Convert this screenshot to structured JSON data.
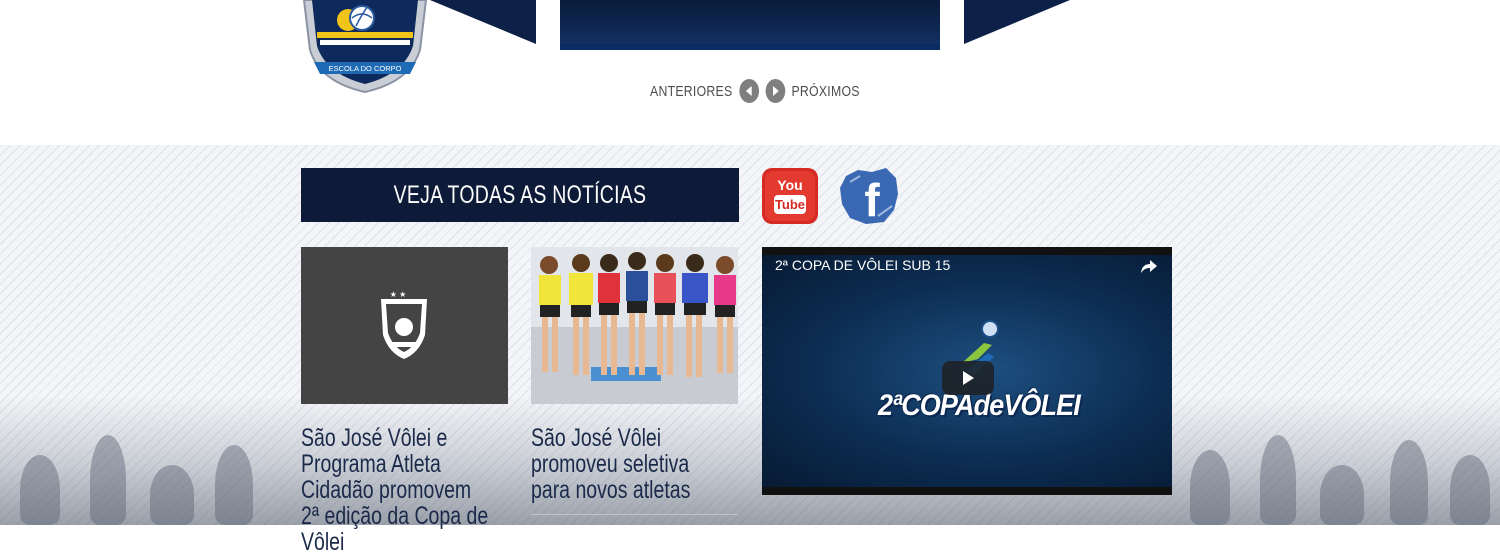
{
  "logo": {
    "label": "ESCOLA DO CORPO"
  },
  "pager": {
    "prev_label": "ANTERIORES",
    "next_label": "PRÓXIMOS"
  },
  "news": {
    "header_label": "VEJA TODAS AS NOTÍCIAS",
    "cards": [
      {
        "title": "São José Vôlei e Programa Atleta Cidadão promovem 2ª edição da Copa de Vôlei"
      },
      {
        "title": "São José Vôlei promoveu seletiva para novos atletas"
      }
    ]
  },
  "social": {
    "youtube_top": "You",
    "youtube_bottom": "Tube",
    "facebook_letter": "f"
  },
  "video": {
    "title": "2ª COPA DE VÔLEI SUB 15",
    "logo_text": "2ªCOPAdeVÔLEI"
  },
  "colors": {
    "navy": "#0e1b38",
    "youtube_red": "#d62a24",
    "facebook_blue": "#3b68b3",
    "pager_grey": "#7f7f7f"
  }
}
